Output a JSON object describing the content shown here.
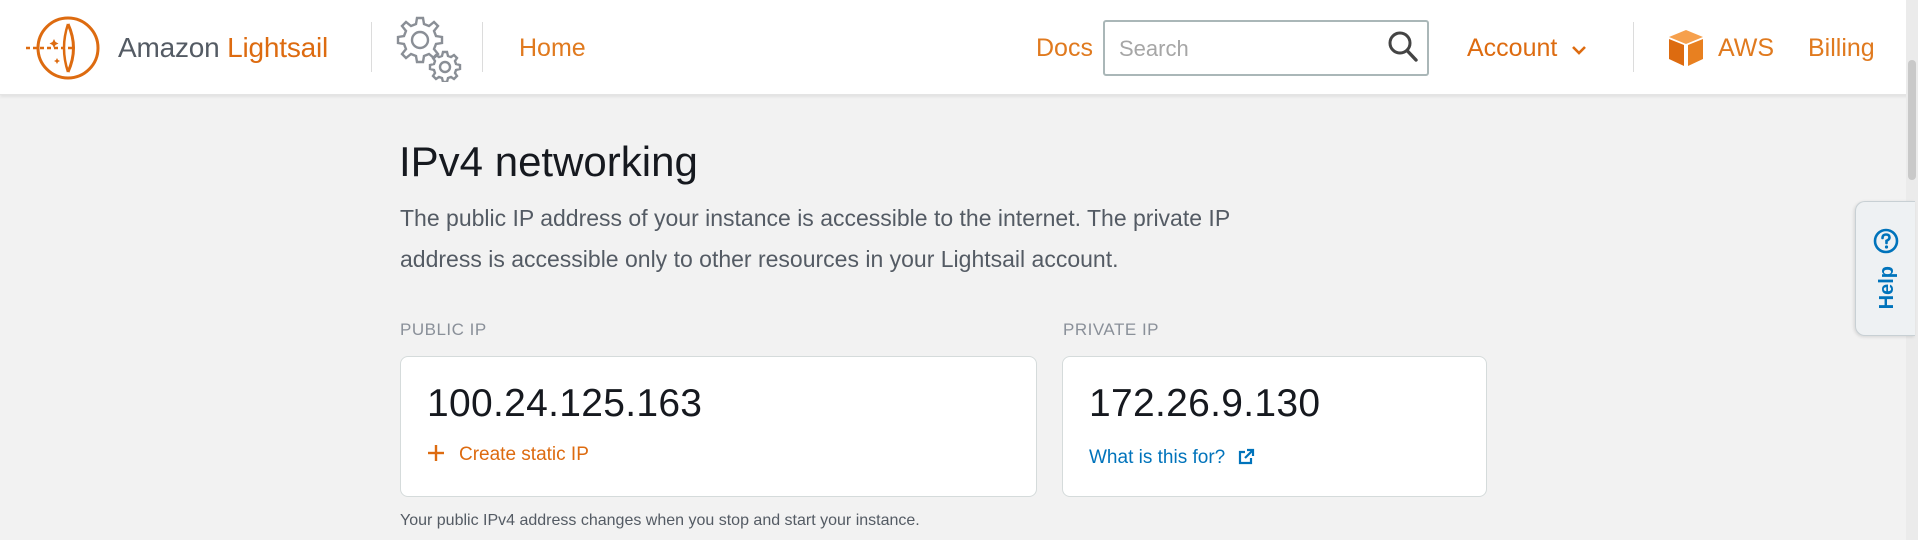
{
  "header": {
    "brand_prefix": "Amazon",
    "brand_name": "Lightsail",
    "home_label": "Home",
    "docs_label": "Docs",
    "search_placeholder": "Search",
    "account_label": "Account",
    "aws_label": "AWS",
    "billing_label": "Billing",
    "icons": {
      "logo": "lightsail-logo-icon",
      "settings": "gear-icon",
      "search": "search-icon",
      "account_menu": "chevron-down-icon",
      "aws": "aws-box-icon"
    },
    "colors": {
      "accent": "#dd6b10",
      "link": "#0073bb"
    }
  },
  "main": {
    "title": "IPv4 networking",
    "description": "The public IP address of your instance is accessible to the internet. The private IP address is accessible only to other resources in your Lightsail account.",
    "public": {
      "label": "PUBLIC IP",
      "address": "100.24.125.163",
      "action_label": "Create static IP",
      "action_icon": "plus-icon"
    },
    "private": {
      "label": "PRIVATE IP",
      "address": "172.26.9.130",
      "action_label": "What is this for?",
      "action_icon": "external-link-icon"
    },
    "footnote": "Your public IPv4 address changes when you stop and start your instance."
  },
  "help": {
    "label": "Help",
    "icon": "question-circle-icon"
  }
}
